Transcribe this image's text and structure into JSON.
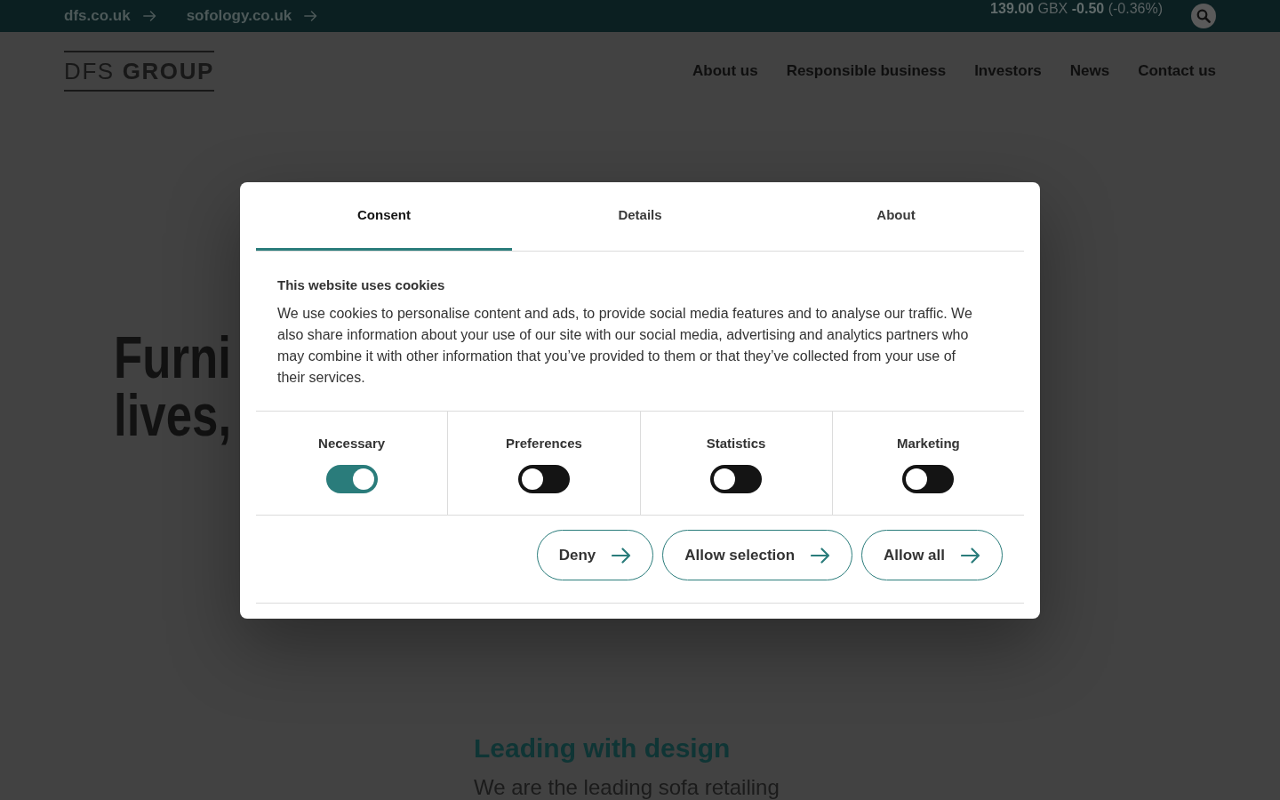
{
  "top_bar": {
    "links": [
      {
        "label": "dfs.co.uk"
      },
      {
        "label": "sofology.co.uk"
      }
    ],
    "share_price": "**139.00** GBX **-0.50** (-0.36%)"
  },
  "header": {
    "logo": "DFS **GROUP**",
    "nav": [
      "About us",
      "Responsible business",
      "Investors",
      "News",
      "Contact us"
    ]
  },
  "hero": {
    "heading_lines": [
      "Furni",
      "lives,"
    ]
  },
  "section": {
    "heading": "Leading with design",
    "text": "We are the leading sofa retailing"
  },
  "cookie_dialog": {
    "tabs": [
      {
        "label": "Consent",
        "selected": true
      },
      {
        "label": "Details",
        "selected": false
      },
      {
        "label": "About",
        "selected": false
      }
    ],
    "title": "This website uses cookies",
    "text": "We use cookies to personalise content and ads, to provide social media features and to analyse our traffic. We also share information about your use of our site with our social media, advertising and analytics partners who may combine it with other information that you’ve provided to them or that they’ve collected from your use of their services.",
    "toggles": [
      {
        "label": "Necessary",
        "checked": true
      },
      {
        "label": "Preferences",
        "checked": false
      },
      {
        "label": "Statistics",
        "checked": false
      },
      {
        "label": "Marketing",
        "checked": false
      }
    ],
    "buttons": [
      "Deny",
      "Allow selection",
      "Allow all"
    ]
  }
}
